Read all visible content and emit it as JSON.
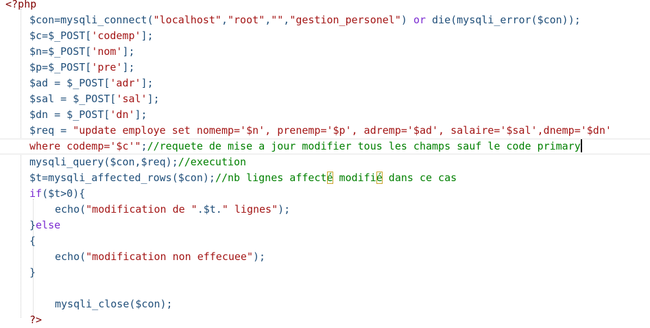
{
  "code": {
    "lines": [
      {
        "segs": [
          {
            "t": "<?php",
            "c": "h"
          }
        ]
      },
      {
        "segs": [
          {
            "t": "$con=mysqli_connect(",
            "c": "t"
          },
          {
            "t": "\"localhost\"",
            "c": "s"
          },
          {
            "t": ",",
            "c": "t"
          },
          {
            "t": "\"root\"",
            "c": "s"
          },
          {
            "t": ",",
            "c": "t"
          },
          {
            "t": "\"\"",
            "c": "s"
          },
          {
            "t": ",",
            "c": "t"
          },
          {
            "t": "\"gestion_personel\"",
            "c": "s"
          },
          {
            "t": ") ",
            "c": "t"
          },
          {
            "t": "or",
            "c": "k"
          },
          {
            "t": " die(mysqli_error($con));",
            "c": "t"
          }
        ]
      },
      {
        "segs": [
          {
            "t": "$c=$_POST[",
            "c": "t"
          },
          {
            "t": "'codemp'",
            "c": "s"
          },
          {
            "t": "];",
            "c": "t"
          }
        ]
      },
      {
        "segs": [
          {
            "t": "$n=$_POST[",
            "c": "t"
          },
          {
            "t": "'nom'",
            "c": "s"
          },
          {
            "t": "];",
            "c": "t"
          }
        ]
      },
      {
        "segs": [
          {
            "t": "$p=$_POST[",
            "c": "t"
          },
          {
            "t": "'pre'",
            "c": "s"
          },
          {
            "t": "];",
            "c": "t"
          }
        ]
      },
      {
        "segs": [
          {
            "t": "$ad = $_POST[",
            "c": "t"
          },
          {
            "t": "'adr'",
            "c": "s"
          },
          {
            "t": "];",
            "c": "t"
          }
        ]
      },
      {
        "segs": [
          {
            "t": "$sal = $_POST[",
            "c": "t"
          },
          {
            "t": "'sal'",
            "c": "s"
          },
          {
            "t": "];",
            "c": "t"
          }
        ]
      },
      {
        "segs": [
          {
            "t": "$dn = $_POST[",
            "c": "t"
          },
          {
            "t": "'dn'",
            "c": "s"
          },
          {
            "t": "];",
            "c": "t"
          }
        ]
      },
      {
        "segs": [
          {
            "t": "$req = ",
            "c": "t"
          },
          {
            "t": "\"update employe set nomemp='$n', prenemp='$p', adremp='$ad', salaire='$sal',dnemp='$dn'",
            "c": "s"
          }
        ]
      },
      {
        "segs": [
          {
            "t": "where codemp='$c'\"",
            "c": "s"
          },
          {
            "t": ";",
            "c": "t"
          },
          {
            "t": "//requete de mise a jour modifier tous les champs sauf le code primary",
            "c": "c"
          }
        ],
        "current": true,
        "caret": true
      },
      {
        "segs": [
          {
            "t": "mysqli_query($con,$req);",
            "c": "t"
          },
          {
            "t": "//execution",
            "c": "c"
          }
        ]
      },
      {
        "segs": [
          {
            "t": "$t=mysqli_affected_rows($con);",
            "c": "t"
          },
          {
            "t": "//nb lignes affect",
            "c": "c"
          },
          {
            "t": "é",
            "c": "c",
            "m": true
          },
          {
            "t": " modifi",
            "c": "c"
          },
          {
            "t": "é",
            "c": "c",
            "m": true
          },
          {
            "t": " dans ce cas",
            "c": "c"
          }
        ]
      },
      {
        "segs": [
          {
            "t": "if",
            "c": "k"
          },
          {
            "t": "($t>0){",
            "c": "t"
          }
        ]
      },
      {
        "indent": 1,
        "segs": [
          {
            "t": "echo(",
            "c": "t"
          },
          {
            "t": "\"modification de \"",
            "c": "s"
          },
          {
            "t": ".$t.",
            "c": "t"
          },
          {
            "t": "\" lignes\"",
            "c": "s"
          },
          {
            "t": ");",
            "c": "t"
          }
        ]
      },
      {
        "segs": [
          {
            "t": "}",
            "c": "t"
          },
          {
            "t": "else",
            "c": "k"
          }
        ]
      },
      {
        "segs": [
          {
            "t": "{",
            "c": "t"
          }
        ]
      },
      {
        "indent": 1,
        "segs": [
          {
            "t": "echo(",
            "c": "t"
          },
          {
            "t": "\"modification non effecuee\"",
            "c": "s"
          },
          {
            "t": ");",
            "c": "t"
          }
        ]
      },
      {
        "segs": [
          {
            "t": "}",
            "c": "t"
          }
        ]
      },
      {
        "segs": []
      },
      {
        "indent": 1,
        "segs": [
          {
            "t": "mysqli_close($con);",
            "c": "t"
          }
        ]
      },
      {
        "segs": [
          {
            "t": "?>",
            "c": "h"
          }
        ]
      }
    ]
  }
}
